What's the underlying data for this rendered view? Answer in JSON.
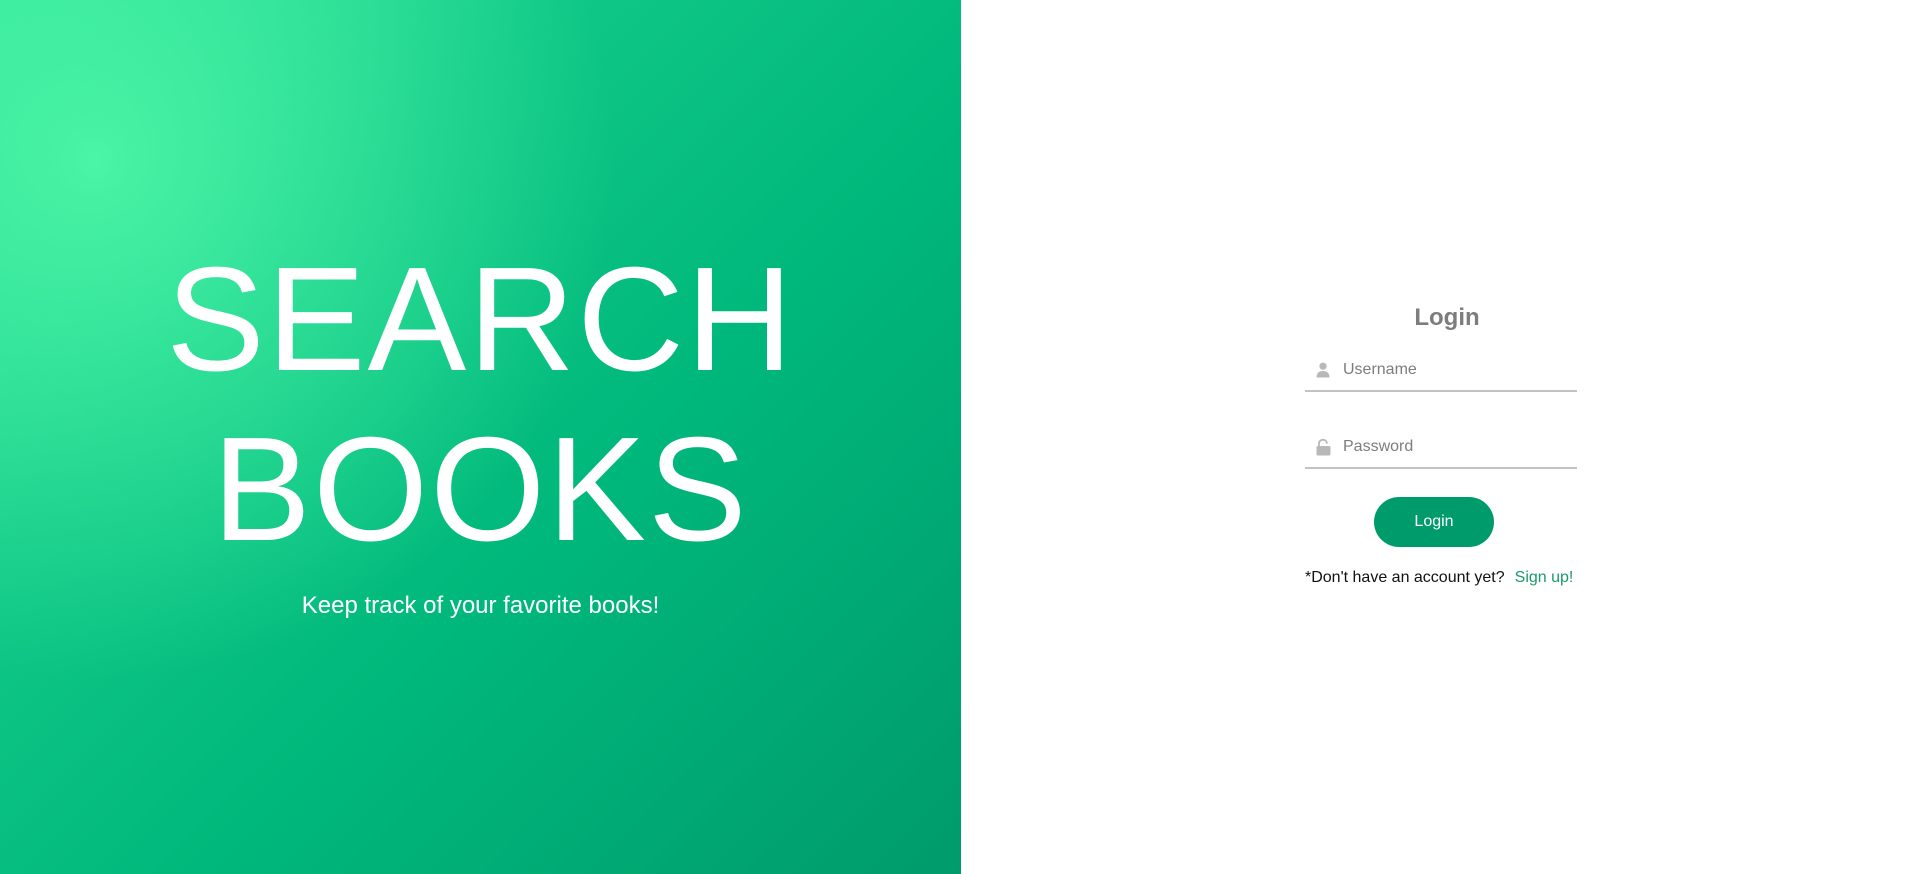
{
  "hero": {
    "title_line1": "SEARCH",
    "title_line2": "BOOKS",
    "subtitle": "Keep track of your favorite books!"
  },
  "login": {
    "heading": "Login",
    "username_placeholder": "Username",
    "username_icon": "user-icon",
    "password_placeholder": "Password",
    "password_icon": "lock-icon",
    "button_label": "Login",
    "signup_prompt": "*Don't have an account yet?",
    "signup_link": "Sign up!"
  },
  "colors": {
    "brand_green": "#009b6b",
    "hero_light_green": "#4cf5a6",
    "link_green": "#1a9a6a",
    "heading_gray": "#7d7d7d"
  }
}
